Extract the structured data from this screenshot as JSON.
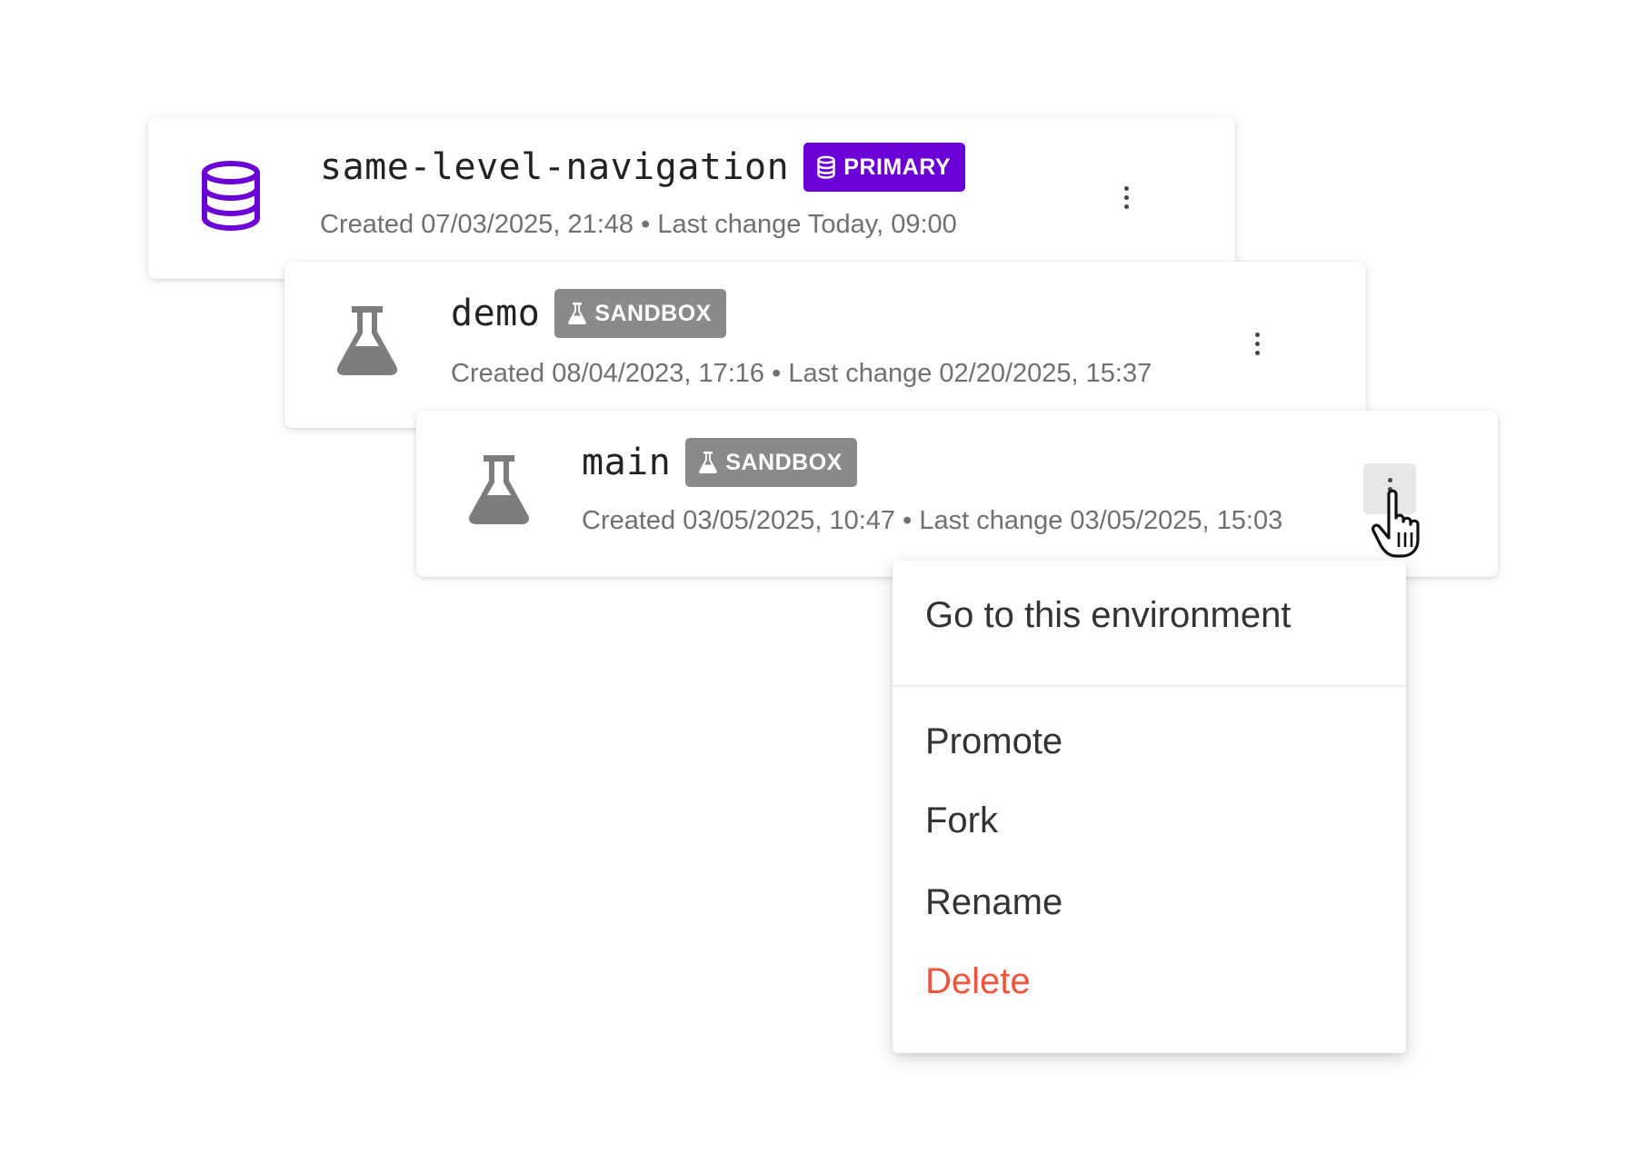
{
  "environments": [
    {
      "name": "same-level-navigation",
      "badge": "PRIMARY",
      "badge_icon": "database-icon",
      "icon": "database-icon",
      "created": "Created 07/03/2025, 21:48",
      "last_change": "Last change Today, 09:00",
      "separator": "•"
    },
    {
      "name": "demo",
      "badge": "SANDBOX",
      "badge_icon": "flask-icon",
      "icon": "flask-icon",
      "created": "Created 08/04/2023, 17:16",
      "last_change": "Last change 02/20/2025, 15:37",
      "separator": "•"
    },
    {
      "name": "main",
      "badge": "SANDBOX",
      "badge_icon": "flask-icon",
      "icon": "flask-icon",
      "created": "Created 03/05/2025, 10:47",
      "last_change": "Last change 03/05/2025, 15:03",
      "separator": "•"
    }
  ],
  "context_menu": {
    "items": [
      "Go to this environment",
      "Promote",
      "Fork",
      "Rename",
      "Delete"
    ]
  },
  "colors": {
    "primary_accent": "#6b00d7",
    "sandbox_badge": "#8a8a8a",
    "danger": "#f1533d",
    "meta_text": "#707070"
  }
}
